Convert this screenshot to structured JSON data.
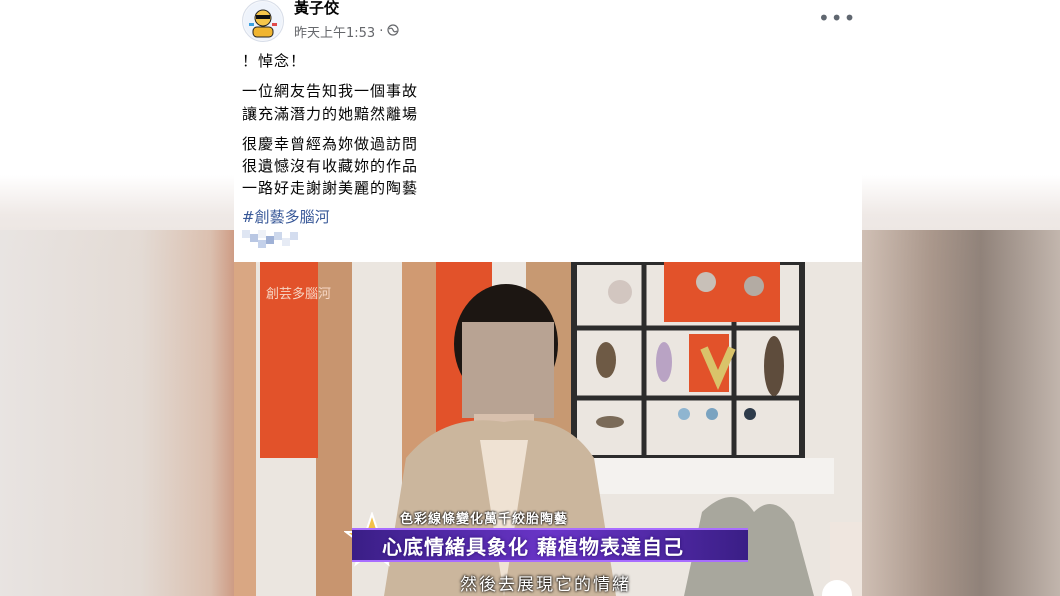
{
  "post": {
    "author": "黃子佼",
    "timestamp": "昨天上午1:53",
    "visibility_icon": "globe-icon",
    "more_label": "•••",
    "lines": [
      "！悼念！",
      "一位網友告知我一個事故",
      "讓充滿潛力的她黯然離場",
      "很慶幸曾經為妳做過訪問",
      "很遺憾沒有收藏妳的作品",
      "一路好走謝謝美麗的陶藝"
    ],
    "hashtag": "#創藝多腦河"
  },
  "video": {
    "show_logo_text": "創芸多腦河",
    "overlay_top": "色彩線條變化萬千絞胎陶藝",
    "overlay_main": "心底情緒具象化  藉植物表達自己",
    "subtitle": "然後去展現它的情緒"
  },
  "colors": {
    "link": "#385898",
    "band": "#5a2db8",
    "show_orange": "#e2522a"
  }
}
